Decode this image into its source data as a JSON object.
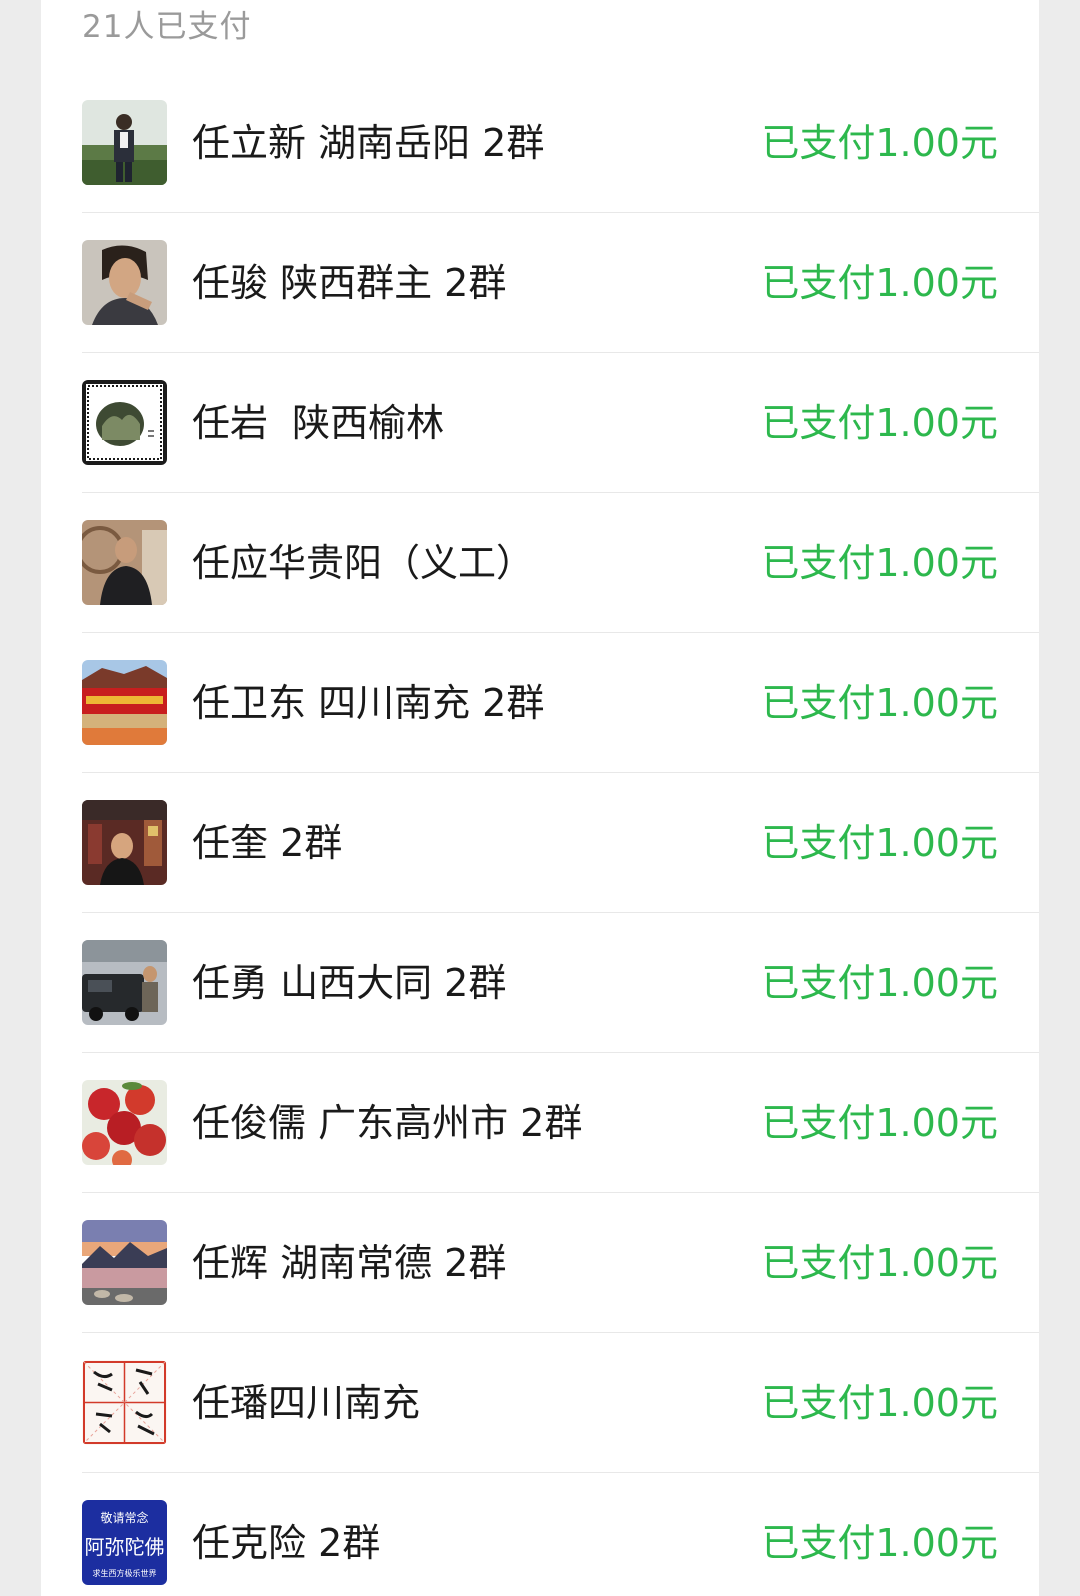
{
  "header": {
    "text": "21人已支付"
  },
  "colors": {
    "amount": "#2db84d",
    "name": "#1a1a1a",
    "header": "#9a9a9a"
  },
  "rows": [
    {
      "name": "任立新 湖南岳阳 2群",
      "amount": "已支付1.00元",
      "avatar_icon": "photo-man-field-avatar"
    },
    {
      "name": "任骏 陕西群主 2群",
      "amount": "已支付1.00元",
      "avatar_icon": "photo-man-portrait-avatar"
    },
    {
      "name": "任岩  陕西榆林",
      "amount": "已支付1.00元",
      "avatar_icon": "stamp-landscape-avatar"
    },
    {
      "name": "任应华贵阳（义工）",
      "amount": "已支付1.00元",
      "avatar_icon": "photo-man-indoor-avatar"
    },
    {
      "name": "任卫东 四川南充 2群",
      "amount": "已支付1.00元",
      "avatar_icon": "banner-building-avatar"
    },
    {
      "name": "任奎 2群",
      "amount": "已支付1.00元",
      "avatar_icon": "photo-man-shop-avatar"
    },
    {
      "name": "任勇 山西大同 2群",
      "amount": "已支付1.00元",
      "avatar_icon": "photo-man-car-avatar"
    },
    {
      "name": "任俊儒 广东高州市 2群",
      "amount": "已支付1.00元",
      "avatar_icon": "apples-avatar"
    },
    {
      "name": "任辉 湖南常德 2群",
      "amount": "已支付1.00元",
      "avatar_icon": "lake-sunset-avatar"
    },
    {
      "name": "任璠四川南充",
      "amount": "已支付1.00元",
      "avatar_icon": "calligraphy-grid-avatar"
    },
    {
      "name": "任克险 2群",
      "amount": "已支付1.00元",
      "avatar_icon": "blue-calligraphy-avatar",
      "avatar_text": {
        "top": "敬请常念",
        "main": "阿弥陀佛",
        "bottom": "求生西方极乐世界"
      }
    }
  ]
}
